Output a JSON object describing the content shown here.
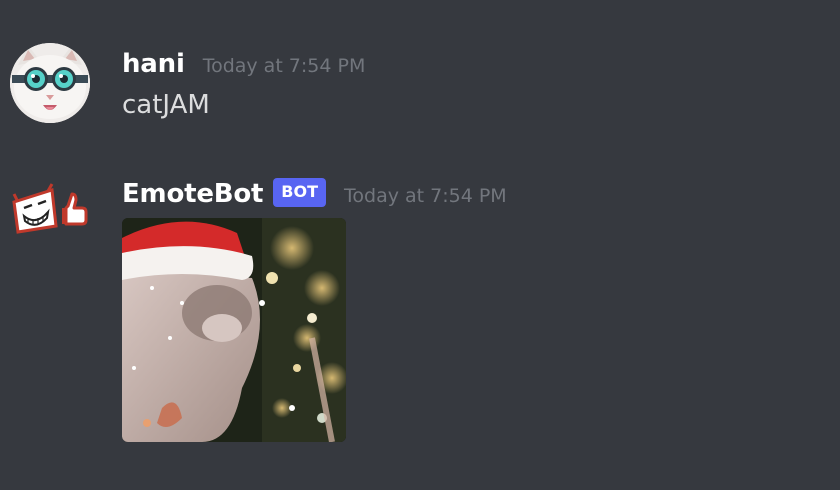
{
  "messages": [
    {
      "author": "hani",
      "timestamp": "Today at 7:54 PM",
      "content": "catJAM",
      "avatar_icon": "cat-with-goggles-avatar"
    },
    {
      "author": "EmoteBot",
      "badge": "BOT",
      "timestamp": "Today at 7:54 PM",
      "avatar_icon": "emotebot-thumbs-up-avatar",
      "attachment": "cat-santa-hat-gif"
    }
  ],
  "colors": {
    "background": "#36393f",
    "username": "#ffffff",
    "message_text": "#dcddde",
    "timestamp": "#72767d",
    "bot_badge": "#5865f2"
  }
}
